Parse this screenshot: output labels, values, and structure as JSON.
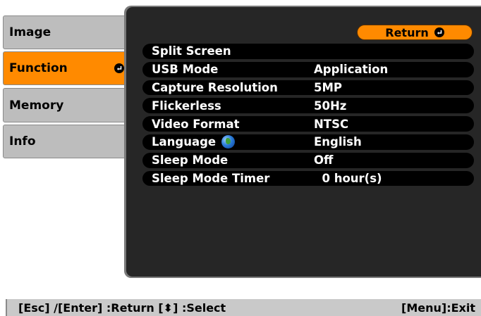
{
  "tabs": [
    {
      "label": "Image",
      "active": false
    },
    {
      "label": "Function",
      "active": true
    },
    {
      "label": "Memory",
      "active": false
    },
    {
      "label": "Info",
      "active": false
    }
  ],
  "return_label": "Return",
  "rows": [
    {
      "label": "Split Screen",
      "value": ""
    },
    {
      "label": "USB Mode",
      "value": "Application"
    },
    {
      "label": "Capture Resolution",
      "value": "5MP"
    },
    {
      "label": "Flickerless",
      "value": "50Hz"
    },
    {
      "label": "Video Format",
      "value": "NTSC"
    },
    {
      "label": "Language",
      "value": "English",
      "icon": "globe-icon"
    },
    {
      "label": "Sleep Mode",
      "value": "Off"
    },
    {
      "label": "Sleep Mode Timer",
      "value": "  0 hour(s)"
    }
  ],
  "bottom_bar": {
    "left_text": "[Esc] /[Enter] :Return  [⬍] :Select",
    "right_text": "[Menu]:Exit"
  },
  "colors": {
    "accent": "#ff8a00",
    "tab_bg": "#bdbdbd",
    "panel_bg": "#262626",
    "row_bg": "#000000",
    "bottom_bar_bg": "#c9c9c9"
  }
}
